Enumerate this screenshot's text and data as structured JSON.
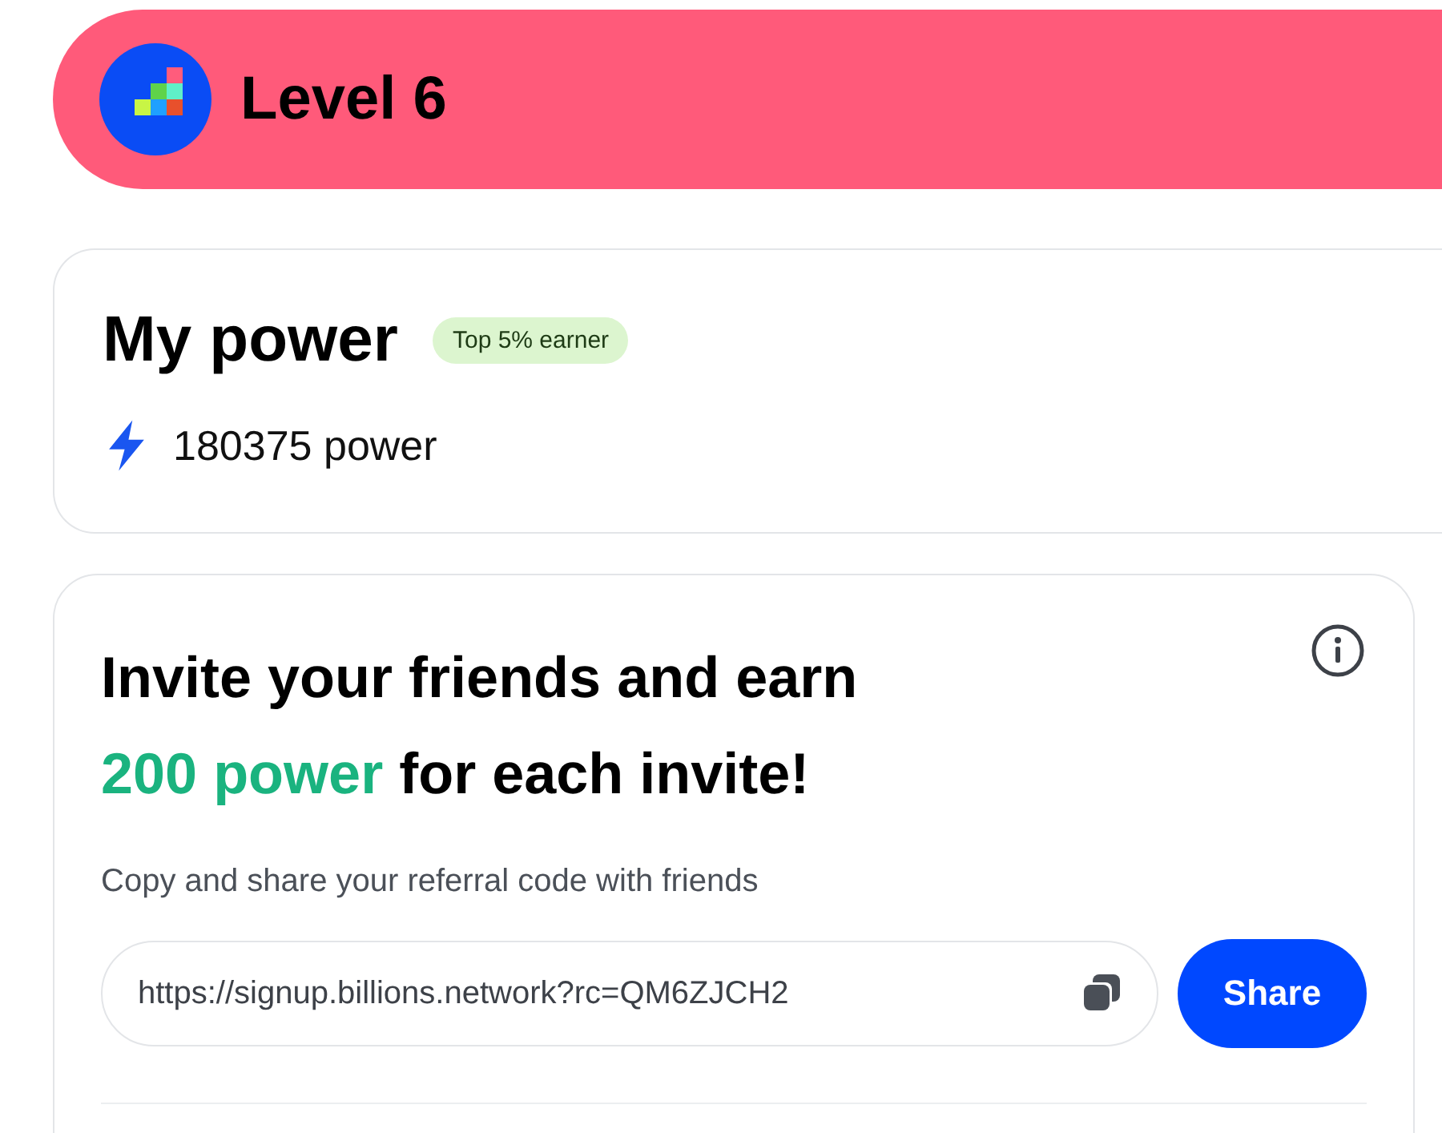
{
  "level_banner": {
    "title": "Level 6"
  },
  "power_card": {
    "title": "My power",
    "badge": "Top 5% earner",
    "amount": "180375 power"
  },
  "invite_card": {
    "title": "Invite your friends and earn",
    "highlight": "200 power",
    "title_end": "for each invite!",
    "description": "Copy and share your referral code with friends",
    "referral_link": "https://signup.billions.network?rc=QM6ZJCH2",
    "share_button": "Share"
  }
}
